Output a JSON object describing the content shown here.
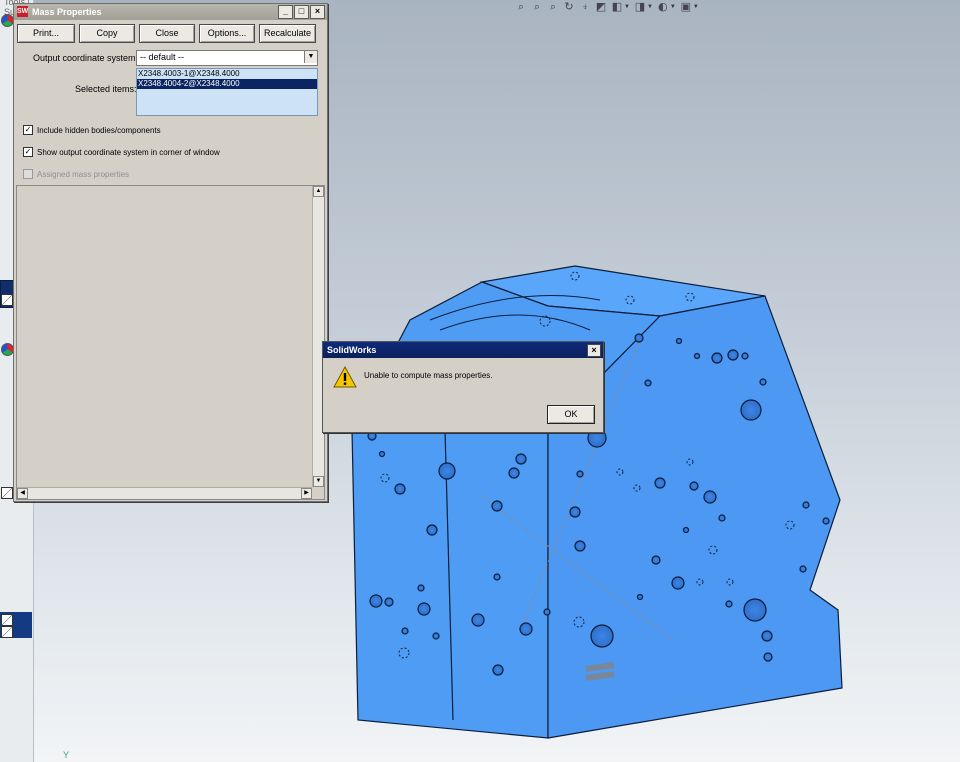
{
  "background": {
    "crumb": "Tools | Surfaces |",
    "axis_label": "Y"
  },
  "mass_properties": {
    "title": "Mass Properties",
    "logo": "SW",
    "buttons": {
      "print": "Print...",
      "copy": "Copy",
      "close": "Close",
      "options": "Options...",
      "recalculate": "Recalculate"
    },
    "output_coord_label": "Output coordinate system:",
    "output_coord_value": "-- default --",
    "selected_items_label": "Selected items:",
    "selected_items": [
      "X2348.4003-1@X2348.4000",
      "X2348.4004-2@X2348.4000"
    ],
    "selected_index": 1,
    "checkboxes": [
      {
        "label": "Include hidden bodies/components",
        "checked": true,
        "enabled": true
      },
      {
        "label": "Show output coordinate system in corner of window",
        "checked": true,
        "enabled": true
      },
      {
        "label": "Assigned mass properties",
        "checked": false,
        "enabled": false
      }
    ]
  },
  "message_box": {
    "title": "SolidWorks",
    "message": "Unable to compute mass properties.",
    "ok_label": "OK"
  },
  "colors": {
    "model": "#4f9cf5",
    "accent": "#0b2462"
  }
}
